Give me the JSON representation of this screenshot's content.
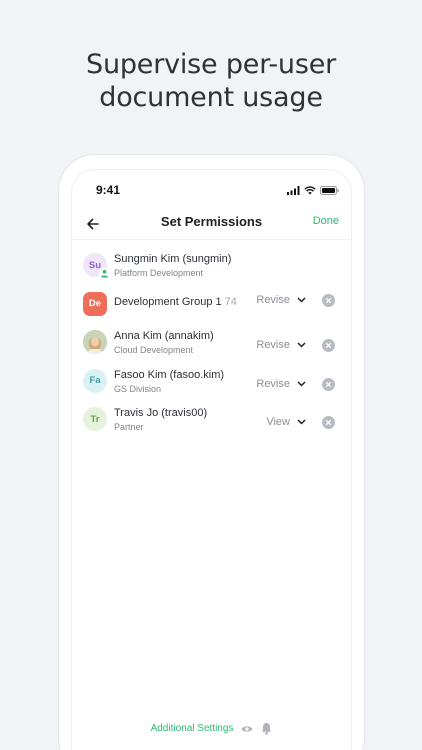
{
  "headline": {
    "line1": "Supervise per-user",
    "line2": "document usage"
  },
  "status_bar": {
    "time": "9:41",
    "icons": [
      "signal-icon",
      "wifi-icon",
      "battery-icon"
    ]
  },
  "nav": {
    "back_icon": "arrow-left-icon",
    "title": "Set Permissions",
    "done_label": "Done",
    "accent_color": "#2eb872"
  },
  "members": [
    {
      "avatar_text": "Su",
      "avatar_bg": "#efe6fa",
      "avatar_fg": "#8b62c8",
      "badge_icon": "owner-person-icon",
      "name": "Sungmin Kim (sungmin)",
      "sub": "Platform Development"
    },
    {
      "avatar_text": "De",
      "avatar_bg": "#ee6e5a",
      "avatar_fg": "#ffffff",
      "name": "Development Group 1",
      "count": "74",
      "permission": "Revise"
    },
    {
      "avatar_image": "profile-photo",
      "name": "Anna Kim  (annakim)",
      "sub": "Cloud Development",
      "permission": "Revise"
    },
    {
      "avatar_text": "Fa",
      "avatar_bg": "#d9f1f3",
      "avatar_fg": "#3f9da5",
      "name": "Fasoo Kim (fasoo.kim)",
      "sub": "GS Division",
      "permission": "Revise"
    },
    {
      "avatar_text": "Tr",
      "avatar_bg": "#e6f2dc",
      "avatar_fg": "#6a9e4a",
      "name": "Travis Jo (travis00)",
      "sub": "Partner",
      "permission": "View"
    }
  ],
  "footer": {
    "additional_settings": "Additional Settings",
    "icons": [
      "eye-icon",
      "bell-icon"
    ]
  }
}
